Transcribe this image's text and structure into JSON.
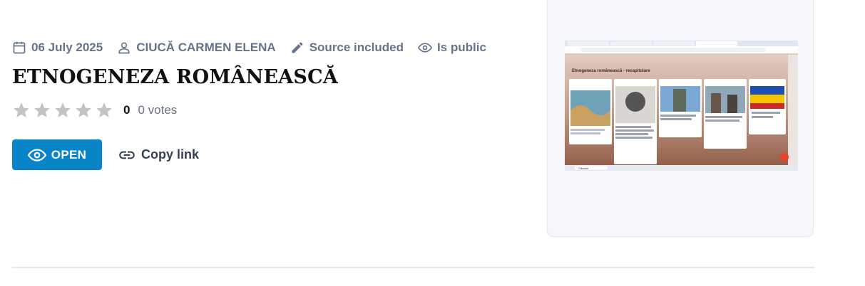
{
  "meta": {
    "date": "06 July 2025",
    "author": "CIUCĂ CARMEN ELENA",
    "source": "Source included",
    "visibility": "Is public"
  },
  "title": "ETNOGENEZA ROMÂNEASCĂ",
  "rating": {
    "value": "0",
    "votes": "0 votes",
    "max_stars": 5,
    "filled_stars": 0
  },
  "actions": {
    "open_label": "OPEN",
    "copy_link_label": "Copy link"
  },
  "colors": {
    "accent": "#0a84c8",
    "star_empty": "#c4c4c4",
    "meta_text": "#64748b"
  },
  "icons": {
    "date": "calendar-icon",
    "author": "person-icon",
    "source": "pencil-icon",
    "visibility": "eye-icon",
    "open": "eye-icon",
    "copy": "link-icon"
  },
  "thumbnail": {
    "board_title": "Etnogeneza românească - recapitulare",
    "search_taskbar": "Căutare"
  }
}
